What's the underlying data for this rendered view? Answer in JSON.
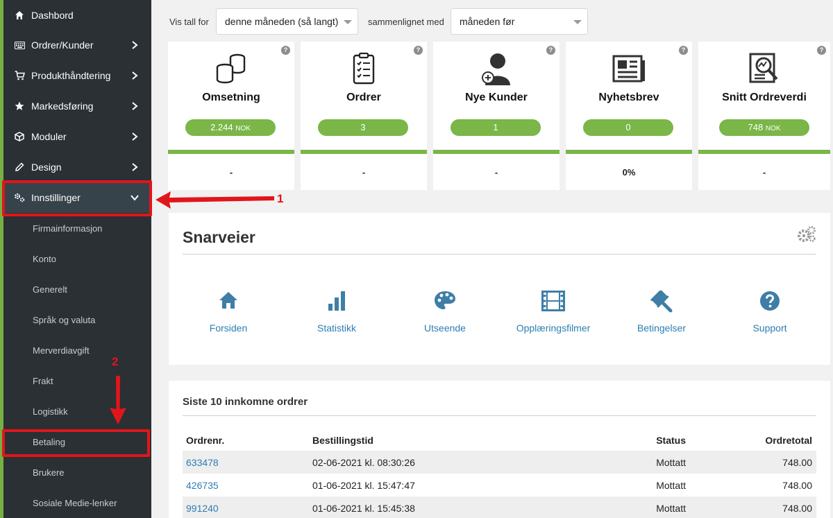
{
  "sidebar": {
    "items": [
      {
        "label": "Dashbord",
        "icon": "home-icon"
      },
      {
        "label": "Ordrer/Kunder",
        "icon": "keyboard-icon"
      },
      {
        "label": "Produkthåndtering",
        "icon": "cart-icon"
      },
      {
        "label": "Markedsføring",
        "icon": "star-icon"
      },
      {
        "label": "Moduler",
        "icon": "cube-icon"
      },
      {
        "label": "Design",
        "icon": "pencil-icon"
      },
      {
        "label": "Innstillinger",
        "icon": "cogs-icon"
      }
    ],
    "subitems": [
      {
        "label": "Firmainformasjon"
      },
      {
        "label": "Konto"
      },
      {
        "label": "Generelt"
      },
      {
        "label": "Språk og valuta"
      },
      {
        "label": "Merverdiavgift"
      },
      {
        "label": "Frakt"
      },
      {
        "label": "Logistikk"
      },
      {
        "label": "Betaling"
      },
      {
        "label": "Brukere"
      },
      {
        "label": "Sosiale Medie-lenker"
      }
    ]
  },
  "filters": {
    "show_label": "Vis tall for",
    "period": "denne måneden (så langt)",
    "compare_label": "sammenlignet med",
    "compare": "måneden før"
  },
  "stats": [
    {
      "title": "Omsetning",
      "value": "2.244",
      "unit": "NOK",
      "change": "-",
      "icon": "coins-icon"
    },
    {
      "title": "Ordrer",
      "value": "3",
      "unit": "",
      "change": "-",
      "icon": "clipboard-icon"
    },
    {
      "title": "Nye Kunder",
      "value": "1",
      "unit": "",
      "change": "-",
      "icon": "user-plus-icon"
    },
    {
      "title": "Nyhetsbrev",
      "value": "0",
      "unit": "",
      "change": "0%",
      "icon": "newspaper-icon"
    },
    {
      "title": "Snitt Ordreverdi",
      "value": "748",
      "unit": "NOK",
      "change": "-",
      "icon": "report-search-icon"
    }
  ],
  "shortcuts": {
    "title": "Snarveier",
    "items": [
      {
        "label": "Forsiden",
        "icon": "home-icon"
      },
      {
        "label": "Statistikk",
        "icon": "bar-chart-icon"
      },
      {
        "label": "Utseende",
        "icon": "palette-icon"
      },
      {
        "label": "Opplæringsfilmer",
        "icon": "film-icon"
      },
      {
        "label": "Betingelser",
        "icon": "gavel-icon"
      },
      {
        "label": "Support",
        "icon": "question-circle-icon"
      }
    ]
  },
  "orders": {
    "title": "Siste 10 innkomne ordrer",
    "columns": [
      "Ordrenr.",
      "Bestillingstid",
      "Status",
      "Ordretotal"
    ],
    "rows": [
      {
        "id": "633478",
        "time": "02-06-2021 kl. 08:30:26",
        "status": "Mottatt",
        "total": "748.00"
      },
      {
        "id": "426735",
        "time": "01-06-2021 kl. 15:47:47",
        "status": "Mottatt",
        "total": "748.00"
      },
      {
        "id": "991240",
        "time": "01-06-2021 kl. 15:45:38",
        "status": "Mottatt",
        "total": "748.00"
      }
    ]
  },
  "annotations": {
    "callout_1": "1",
    "callout_2": "2",
    "color": "#e2151b"
  },
  "colors": {
    "sidebar": "#2a3034",
    "accent_green": "#76b043",
    "link_blue": "#2b7db3"
  }
}
